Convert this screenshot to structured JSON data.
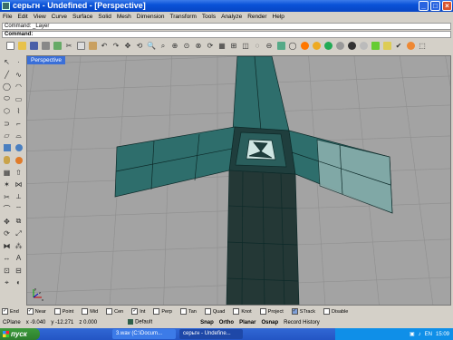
{
  "window": {
    "title": "серьгн - Undefined - [Perspective]",
    "controls": [
      "_",
      "□",
      "×"
    ]
  },
  "menu": [
    "File",
    "Edit",
    "View",
    "Curve",
    "Surface",
    "Solid",
    "Mesh",
    "Dimension",
    "Transform",
    "Tools",
    "Analyze",
    "Render",
    "Help"
  ],
  "command": {
    "history": "Command: _Layer",
    "prompt": "Command:"
  },
  "viewport": {
    "tab": "Perspective",
    "axes": {
      "y": "y",
      "x": "x",
      "z": "z"
    }
  },
  "osnap": [
    {
      "label": "End",
      "checked": true
    },
    {
      "label": "Near",
      "checked": true
    },
    {
      "label": "Point",
      "checked": false
    },
    {
      "label": "Mid",
      "checked": false
    },
    {
      "label": "Cen",
      "checked": false
    },
    {
      "label": "Int",
      "checked": true
    },
    {
      "label": "Perp",
      "checked": false
    },
    {
      "label": "Tan",
      "checked": false
    },
    {
      "label": "Quad",
      "checked": false
    },
    {
      "label": "Knot",
      "checked": false
    },
    {
      "label": "Project",
      "checked": false
    },
    {
      "label": "STrack",
      "checked": true
    },
    {
      "label": "Disable",
      "checked": false
    }
  ],
  "status": {
    "cplane": "CPlane",
    "x": "x -9.040",
    "y": "y -12.271",
    "z": "z 0.000",
    "layer": "Default",
    "buttons": [
      "Snap",
      "Ortho",
      "Planar",
      "Osnap",
      "Record History"
    ]
  },
  "taskbar": {
    "start": "пуск",
    "items": [
      "3.wav (C:\\Docum...",
      "серьгн - Undefine..."
    ],
    "lang": "EN",
    "time": "15:09"
  },
  "colors": {
    "model": "#2e6e6c",
    "model_dark": "#1f3e3d",
    "viewport": "#a3a3a3",
    "titlebar": "#0a52d8"
  }
}
